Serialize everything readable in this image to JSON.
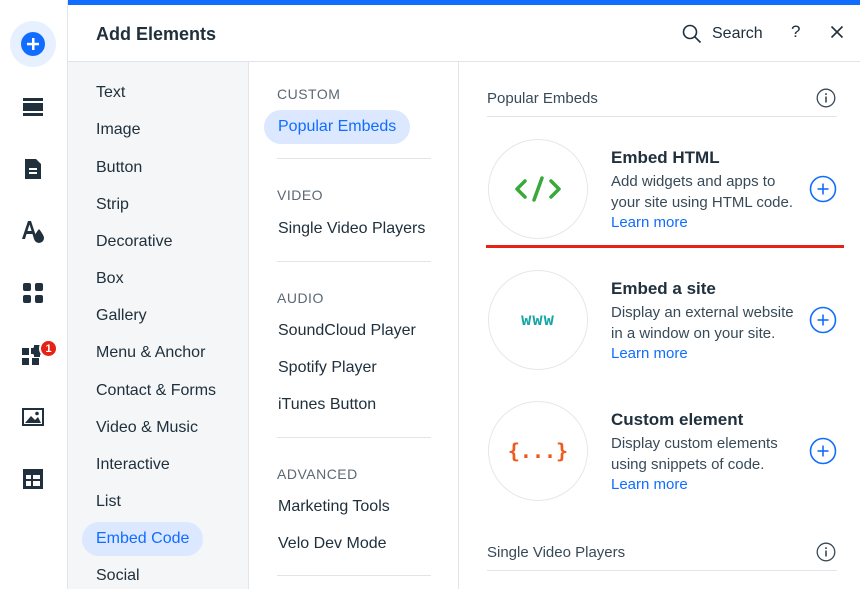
{
  "header": {
    "title": "Add Elements",
    "search_label": "Search",
    "help_label": "?"
  },
  "rail": {
    "icons": [
      "add-icon",
      "sections-icon",
      "pages-icon",
      "design-icon",
      "apps-icon",
      "business-apps-icon",
      "media-icon",
      "cms-icon"
    ],
    "badge_count": "1"
  },
  "categories": [
    {
      "label": "Text"
    },
    {
      "label": "Image"
    },
    {
      "label": "Button"
    },
    {
      "label": "Strip"
    },
    {
      "label": "Decorative"
    },
    {
      "label": "Box"
    },
    {
      "label": "Gallery"
    },
    {
      "label": "Menu & Anchor"
    },
    {
      "label": "Contact & Forms"
    },
    {
      "label": "Video & Music"
    },
    {
      "label": "Interactive"
    },
    {
      "label": "List"
    },
    {
      "label": "Embed Code",
      "selected": true
    },
    {
      "label": "Social"
    }
  ],
  "subnav": {
    "custom_head": "CUSTOM",
    "custom_items": [
      "Popular Embeds"
    ],
    "video_head": "VIDEO",
    "video_items": [
      "Single Video Players"
    ],
    "audio_head": "AUDIO",
    "audio_items": [
      "SoundCloud Player",
      "Spotify Player",
      "iTunes Button"
    ],
    "advanced_head": "ADVANCED",
    "advanced_items": [
      "Marketing Tools",
      "Velo Dev Mode"
    ]
  },
  "content": {
    "popular_title": "Popular Embeds",
    "cards": [
      {
        "title": "Embed HTML",
        "desc": "Add widgets and apps to your site using HTML code.",
        "learn": "Learn more",
        "icon_text": "</>"
      },
      {
        "title": "Embed a site",
        "desc": "Display an external website in a window on your site.",
        "learn": "Learn more",
        "icon_text": "www"
      },
      {
        "title": "Custom element",
        "desc": "Display custom elements using snippets of code.",
        "learn": "Learn more",
        "icon_text": "{...}"
      }
    ],
    "next_section_title": "Single Video Players"
  },
  "colors": {
    "accent": "#116dff",
    "selected_bg": "#dbe8ff",
    "html_icon": "#3aa83a",
    "www_icon": "#17a6a6",
    "custom_icon": "#ee5a1d",
    "red_marker": "#e62214"
  }
}
